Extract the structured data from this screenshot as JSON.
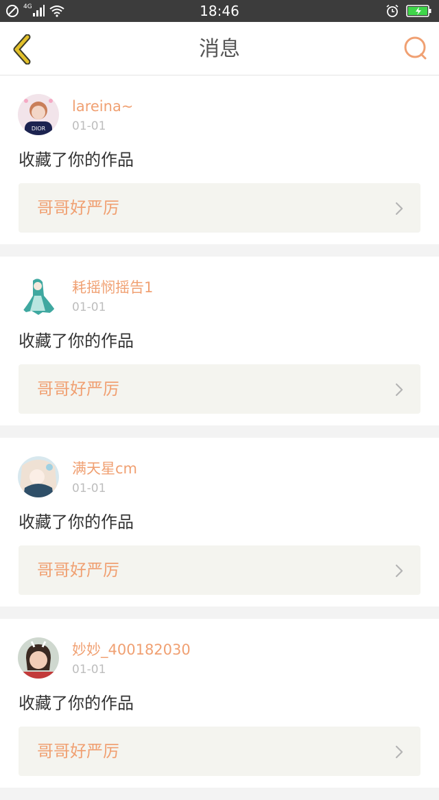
{
  "status_bar": {
    "time": "18:46",
    "network": "4G",
    "icons": [
      "no-disturb-icon",
      "signal-icon",
      "wifi-icon",
      "alarm-icon",
      "battery-charging-icon"
    ]
  },
  "header": {
    "title": "消息",
    "back_icon": "chevron-left-icon",
    "search_icon": "search-icon"
  },
  "messages": [
    {
      "username": "lareina~",
      "date": "01-01",
      "action": "收藏了你的作品",
      "work_title": "哥哥好严厉"
    },
    {
      "username": "耗摇悯摇告1",
      "date": "01-01",
      "action": "收藏了你的作品",
      "work_title": "哥哥好严厉"
    },
    {
      "username": "满天星cm",
      "date": "01-01",
      "action": "收藏了你的作品",
      "work_title": "哥哥好严厉"
    },
    {
      "username": "妙妙_400182030",
      "date": "01-01",
      "action": "收藏了你的作品",
      "work_title": "哥哥好严厉"
    }
  ],
  "colors": {
    "accent": "#f0a072",
    "back_icon": "#e2c02a",
    "status_bar_bg": "#3c3c3c",
    "card_bg": "#ffffff",
    "work_bg": "#f4f4ef",
    "page_bg": "#f3f3f3"
  }
}
